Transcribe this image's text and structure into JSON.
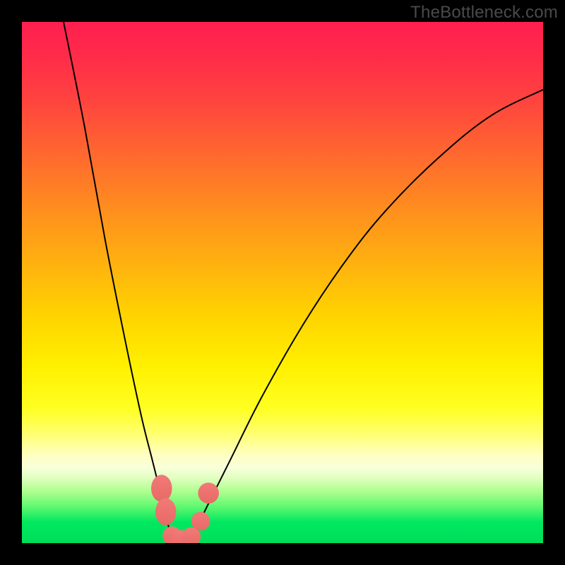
{
  "watermark": "TheBottleneck.com",
  "colors": {
    "background": "#000000",
    "curve": "#000000",
    "marker_fill_start": "#f27a77",
    "marker_fill_end": "#e76a66"
  },
  "chart_data": {
    "type": "line",
    "title": "",
    "xlabel": "",
    "ylabel": "",
    "xlim": [
      0,
      100
    ],
    "ylim": [
      0,
      100
    ],
    "grid": false,
    "legend": false,
    "annotations": [
      "TheBottleneck.com"
    ],
    "series": [
      {
        "name": "curve",
        "x": [
          8,
          12,
          16,
          20,
          23,
          25,
          27,
          28.5,
          30,
          31.5,
          33,
          36,
          40,
          46,
          54,
          62,
          70,
          80,
          90,
          100
        ],
        "y": [
          100,
          80,
          58,
          38,
          24,
          16,
          8,
          2,
          0,
          0,
          2,
          8,
          16,
          28,
          42,
          54,
          64,
          74,
          82,
          87
        ]
      }
    ],
    "markers": [
      {
        "x": 26.8,
        "y": 10.5,
        "rx": 2.0,
        "ry": 2.6
      },
      {
        "x": 27.6,
        "y": 6.0,
        "rx": 2.0,
        "ry": 2.6
      },
      {
        "x": 28.8,
        "y": 1.4,
        "rx": 1.8,
        "ry": 1.8
      },
      {
        "x": 30.5,
        "y": 0.7,
        "rx": 1.8,
        "ry": 1.8
      },
      {
        "x": 32.5,
        "y": 1.2,
        "rx": 1.8,
        "ry": 1.8
      },
      {
        "x": 34.3,
        "y": 4.2,
        "rx": 1.8,
        "ry": 1.8
      },
      {
        "x": 35.8,
        "y": 9.6,
        "rx": 2.0,
        "ry": 2.0
      }
    ]
  }
}
